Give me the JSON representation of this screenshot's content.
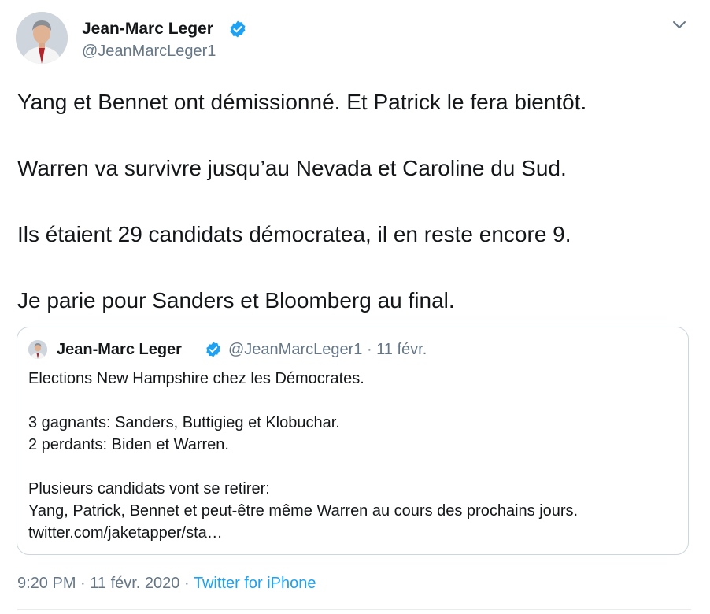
{
  "author": {
    "name": "Jean-Marc Leger",
    "handle": "@JeanMarcLeger1",
    "verified": true
  },
  "tweet": {
    "lines": [
      "Yang et Bennet ont démissionné. Et Patrick le fera bientôt.",
      "Warren va survivre jusqu’au Nevada et Caroline du Sud.",
      "Ils étaient 29 candidats démocratea, il en reste encore 9.",
      "Je parie pour Sanders et Bloomberg au final."
    ]
  },
  "quoted": {
    "name": "Jean-Marc Leger",
    "meta": "@JeanMarcLeger1 · 11 févr.",
    "lines": [
      "Elections New Hampshire chez les Démocrates.",
      "3 gagnants: Sanders, Buttigieg et Klobuchar.",
      "2 perdants: Biden et Warren.",
      "Plusieurs candidats vont se retirer:",
      "Yang, Patrick, Bennet et peut-être même Warren au cours des prochains jours.",
      "twitter.com/jaketapper/sta…"
    ]
  },
  "footer": {
    "time": "9:20 PM · 11 févr. 2020",
    "separator": " · ",
    "source": "Twitter for iPhone"
  },
  "colors": {
    "verified_badge": "#1da1f2",
    "link": "#1da1f2",
    "secondary_text": "#657786",
    "border": "#ccd6dd"
  },
  "icons": {
    "verified": "verified-badge-icon",
    "menu": "chevron-down-icon"
  }
}
